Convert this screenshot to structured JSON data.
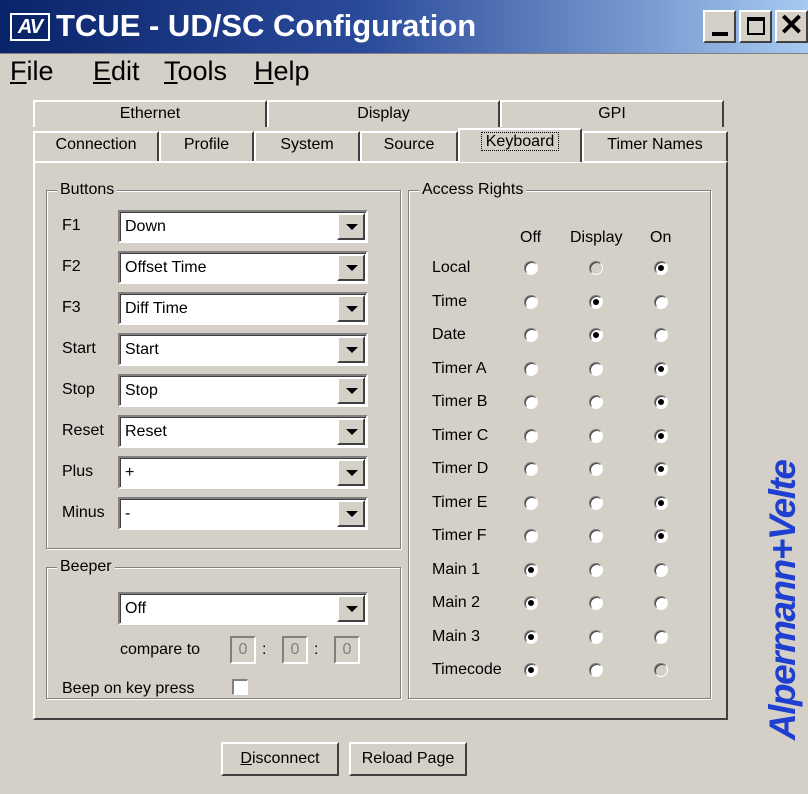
{
  "window": {
    "icon_text": "AV",
    "title": "TCUE - UD/SC Configuration"
  },
  "menu": {
    "file": {
      "u": "F",
      "rest": "ile"
    },
    "edit": {
      "u": "E",
      "rest": "dit"
    },
    "tools": {
      "u": "T",
      "rest": "ools"
    },
    "help": {
      "u": "H",
      "rest": "elp"
    }
  },
  "tabs": {
    "row1": [
      "Ethernet",
      "Display",
      "GPI"
    ],
    "row2": [
      "Connection",
      "Profile",
      "System",
      "Source",
      "Keyboard",
      "Timer Names"
    ],
    "active": "Keyboard"
  },
  "buttons_group": {
    "legend": "Buttons",
    "rows": [
      {
        "label": "F1",
        "value": "Down"
      },
      {
        "label": "F2",
        "value": "Offset Time"
      },
      {
        "label": "F3",
        "value": "Diff Time"
      },
      {
        "label": "Start",
        "value": "Start"
      },
      {
        "label": "Stop",
        "value": "Stop"
      },
      {
        "label": "Reset",
        "value": "Reset"
      },
      {
        "label": "Plus",
        "value": "+"
      },
      {
        "label": "Minus",
        "value": "-"
      }
    ]
  },
  "beeper_group": {
    "legend": "Beeper",
    "value": "Off",
    "compare_label": "compare to",
    "compare_values": [
      "0",
      "0",
      "0"
    ],
    "separator": ":",
    "beep_label": "Beep on key press",
    "beep_checked": false
  },
  "access_group": {
    "legend": "Access Rights",
    "columns": [
      "Off",
      "Display",
      "On"
    ],
    "rows": [
      {
        "label": "Local",
        "selected": "On",
        "disabled": [
          "Display"
        ]
      },
      {
        "label": "Time",
        "selected": "Display"
      },
      {
        "label": "Date",
        "selected": "Display"
      },
      {
        "label": "Timer A",
        "selected": "On"
      },
      {
        "label": "Timer B",
        "selected": "On"
      },
      {
        "label": "Timer C",
        "selected": "On"
      },
      {
        "label": "Timer D",
        "selected": "On"
      },
      {
        "label": "Timer E",
        "selected": "On"
      },
      {
        "label": "Timer F",
        "selected": "On"
      },
      {
        "label": "Main 1",
        "selected": "Off"
      },
      {
        "label": "Main 2",
        "selected": "Off"
      },
      {
        "label": "Main 3",
        "selected": "Off"
      },
      {
        "label": "Timecode",
        "selected": "Off",
        "disabled": [
          "On"
        ]
      }
    ]
  },
  "footer": {
    "disconnect": {
      "u": "D",
      "rest": "isconnect"
    },
    "reload": "Reload Page"
  },
  "logo": "Alpermann+Velte",
  "colors": {
    "titlebar": "#0a246a",
    "logo": "#1f3fd0",
    "face": "#d4d0c8"
  }
}
